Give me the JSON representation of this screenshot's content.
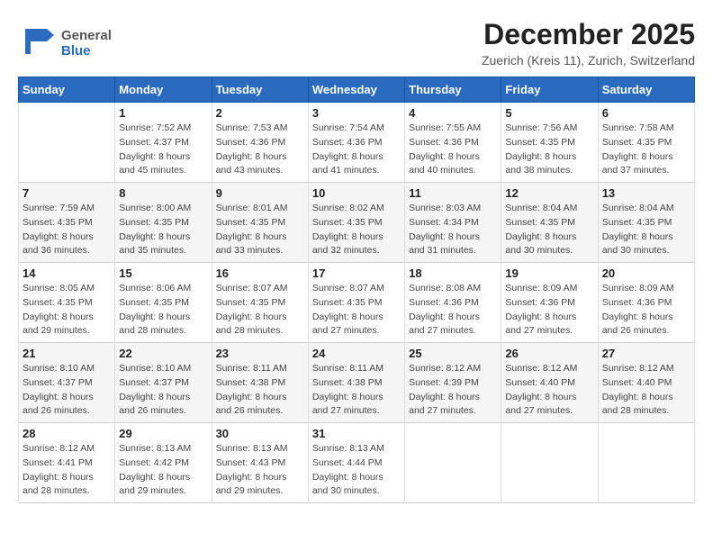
{
  "logo": {
    "text_general": "General",
    "text_blue": "Blue"
  },
  "header": {
    "month": "December 2025",
    "location": "Zuerich (Kreis 11), Zurich, Switzerland"
  },
  "weekdays": [
    "Sunday",
    "Monday",
    "Tuesday",
    "Wednesday",
    "Thursday",
    "Friday",
    "Saturday"
  ],
  "weeks": [
    {
      "days": [
        {
          "num": "",
          "info": ""
        },
        {
          "num": "1",
          "info": "Sunrise: 7:52 AM\nSunset: 4:37 PM\nDaylight: 8 hours\nand 45 minutes."
        },
        {
          "num": "2",
          "info": "Sunrise: 7:53 AM\nSunset: 4:36 PM\nDaylight: 8 hours\nand 43 minutes."
        },
        {
          "num": "3",
          "info": "Sunrise: 7:54 AM\nSunset: 4:36 PM\nDaylight: 8 hours\nand 41 minutes."
        },
        {
          "num": "4",
          "info": "Sunrise: 7:55 AM\nSunset: 4:36 PM\nDaylight: 8 hours\nand 40 minutes."
        },
        {
          "num": "5",
          "info": "Sunrise: 7:56 AM\nSunset: 4:35 PM\nDaylight: 8 hours\nand 38 minutes."
        },
        {
          "num": "6",
          "info": "Sunrise: 7:58 AM\nSunset: 4:35 PM\nDaylight: 8 hours\nand 37 minutes."
        }
      ]
    },
    {
      "days": [
        {
          "num": "7",
          "info": "Sunrise: 7:59 AM\nSunset: 4:35 PM\nDaylight: 8 hours\nand 36 minutes."
        },
        {
          "num": "8",
          "info": "Sunrise: 8:00 AM\nSunset: 4:35 PM\nDaylight: 8 hours\nand 35 minutes."
        },
        {
          "num": "9",
          "info": "Sunrise: 8:01 AM\nSunset: 4:35 PM\nDaylight: 8 hours\nand 33 minutes."
        },
        {
          "num": "10",
          "info": "Sunrise: 8:02 AM\nSunset: 4:35 PM\nDaylight: 8 hours\nand 32 minutes."
        },
        {
          "num": "11",
          "info": "Sunrise: 8:03 AM\nSunset: 4:34 PM\nDaylight: 8 hours\nand 31 minutes."
        },
        {
          "num": "12",
          "info": "Sunrise: 8:04 AM\nSunset: 4:35 PM\nDaylight: 8 hours\nand 30 minutes."
        },
        {
          "num": "13",
          "info": "Sunrise: 8:04 AM\nSunset: 4:35 PM\nDaylight: 8 hours\nand 30 minutes."
        }
      ]
    },
    {
      "days": [
        {
          "num": "14",
          "info": "Sunrise: 8:05 AM\nSunset: 4:35 PM\nDaylight: 8 hours\nand 29 minutes."
        },
        {
          "num": "15",
          "info": "Sunrise: 8:06 AM\nSunset: 4:35 PM\nDaylight: 8 hours\nand 28 minutes."
        },
        {
          "num": "16",
          "info": "Sunrise: 8:07 AM\nSunset: 4:35 PM\nDaylight: 8 hours\nand 28 minutes."
        },
        {
          "num": "17",
          "info": "Sunrise: 8:07 AM\nSunset: 4:35 PM\nDaylight: 8 hours\nand 27 minutes."
        },
        {
          "num": "18",
          "info": "Sunrise: 8:08 AM\nSunset: 4:36 PM\nDaylight: 8 hours\nand 27 minutes."
        },
        {
          "num": "19",
          "info": "Sunrise: 8:09 AM\nSunset: 4:36 PM\nDaylight: 8 hours\nand 27 minutes."
        },
        {
          "num": "20",
          "info": "Sunrise: 8:09 AM\nSunset: 4:36 PM\nDaylight: 8 hours\nand 26 minutes."
        }
      ]
    },
    {
      "days": [
        {
          "num": "21",
          "info": "Sunrise: 8:10 AM\nSunset: 4:37 PM\nDaylight: 8 hours\nand 26 minutes."
        },
        {
          "num": "22",
          "info": "Sunrise: 8:10 AM\nSunset: 4:37 PM\nDaylight: 8 hours\nand 26 minutes."
        },
        {
          "num": "23",
          "info": "Sunrise: 8:11 AM\nSunset: 4:38 PM\nDaylight: 8 hours\nand 26 minutes."
        },
        {
          "num": "24",
          "info": "Sunrise: 8:11 AM\nSunset: 4:38 PM\nDaylight: 8 hours\nand 27 minutes."
        },
        {
          "num": "25",
          "info": "Sunrise: 8:12 AM\nSunset: 4:39 PM\nDaylight: 8 hours\nand 27 minutes."
        },
        {
          "num": "26",
          "info": "Sunrise: 8:12 AM\nSunset: 4:40 PM\nDaylight: 8 hours\nand 27 minutes."
        },
        {
          "num": "27",
          "info": "Sunrise: 8:12 AM\nSunset: 4:40 PM\nDaylight: 8 hours\nand 28 minutes."
        }
      ]
    },
    {
      "days": [
        {
          "num": "28",
          "info": "Sunrise: 8:12 AM\nSunset: 4:41 PM\nDaylight: 8 hours\nand 28 minutes."
        },
        {
          "num": "29",
          "info": "Sunrise: 8:13 AM\nSunset: 4:42 PM\nDaylight: 8 hours\nand 29 minutes."
        },
        {
          "num": "30",
          "info": "Sunrise: 8:13 AM\nSunset: 4:43 PM\nDaylight: 8 hours\nand 29 minutes."
        },
        {
          "num": "31",
          "info": "Sunrise: 8:13 AM\nSunset: 4:44 PM\nDaylight: 8 hours\nand 30 minutes."
        },
        {
          "num": "",
          "info": ""
        },
        {
          "num": "",
          "info": ""
        },
        {
          "num": "",
          "info": ""
        }
      ]
    }
  ]
}
